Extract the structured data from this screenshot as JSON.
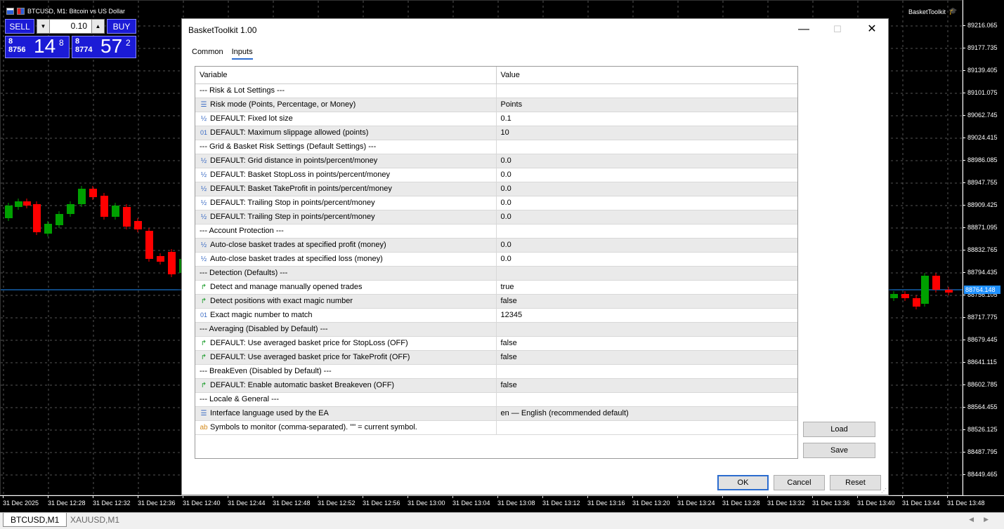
{
  "chart": {
    "symbol_title": "BTCUSD, M1:  Bitcoin vs US Dollar",
    "ea_name": "BasketToolkit",
    "price_ticks": [
      "89216.065",
      "89177.735",
      "89139.405",
      "89101.075",
      "89062.745",
      "89024.415",
      "88986.085",
      "88947.755",
      "88909.425",
      "88871.095",
      "88832.765",
      "88794.435",
      "88756.105",
      "88717.775",
      "88679.445",
      "88641.115",
      "88602.785",
      "88564.455",
      "88526.125",
      "88487.795",
      "88449.465"
    ],
    "current_price": "88764.148",
    "time_ticks": [
      "31 Dec 2025",
      "31 Dec 12:28",
      "31 Dec 12:32",
      "31 Dec 12:36",
      "31 Dec 12:40",
      "31 Dec 12:44",
      "31 Dec 12:48",
      "31 Dec 12:52",
      "31 Dec 12:56",
      "31 Dec 13:00",
      "31 Dec 13:04",
      "31 Dec 13:08",
      "31 Dec 13:12",
      "31 Dec 13:16",
      "31 Dec 13:20",
      "31 Dec 13:24",
      "31 Dec 13:28",
      "31 Dec 13:32",
      "31 Dec 13:36",
      "31 Dec 13:40",
      "31 Dec 13:44",
      "31 Dec 13:48"
    ],
    "colors": {
      "bull": "#00a000",
      "bear": "#ff0000",
      "price_line": "#1e90ff"
    }
  },
  "trade_panel": {
    "sell_label": "SELL",
    "buy_label": "BUY",
    "volume": "0.10",
    "sell_price": {
      "line1": "8",
      "line2": "8756",
      "big": "14",
      "sup": "8"
    },
    "buy_price": {
      "line1": "8",
      "line2": "8774",
      "big": "57",
      "sup": "2"
    }
  },
  "tabs_bottom": [
    "BTCUSD,M1",
    "XAUUSD,M1"
  ],
  "dialog": {
    "title": "BasketToolkit 1.00",
    "tabs": [
      "Common",
      "Inputs"
    ],
    "active_tab": "Inputs",
    "col_variable": "Variable",
    "col_value": "Value",
    "rows": [
      {
        "icon": "",
        "variable": "--- Risk & Lot Settings ---",
        "value": ""
      },
      {
        "icon": "enum",
        "variable": "Risk mode (Points, Percentage, or Money)",
        "value": "Points"
      },
      {
        "icon": "frac",
        "variable": "DEFAULT: Fixed lot size",
        "value": "0.1"
      },
      {
        "icon": "int",
        "variable": "DEFAULT: Maximum slippage allowed (points)",
        "value": "10"
      },
      {
        "icon": "",
        "variable": "--- Grid & Basket Risk Settings (Default Settings) ---",
        "value": ""
      },
      {
        "icon": "frac",
        "variable": "DEFAULT: Grid distance in points/percent/money",
        "value": "0.0"
      },
      {
        "icon": "frac",
        "variable": "DEFAULT: Basket StopLoss in points/percent/money",
        "value": "0.0"
      },
      {
        "icon": "frac",
        "variable": "DEFAULT: Basket TakeProfit in points/percent/money",
        "value": "0.0"
      },
      {
        "icon": "frac",
        "variable": "DEFAULT: Trailing Stop in points/percent/money",
        "value": "0.0"
      },
      {
        "icon": "frac",
        "variable": "DEFAULT: Trailing Step in points/percent/money",
        "value": "0.0"
      },
      {
        "icon": "",
        "variable": "--- Account Protection ---",
        "value": ""
      },
      {
        "icon": "frac",
        "variable": "Auto-close basket trades at specified profit (money)",
        "value": "0.0"
      },
      {
        "icon": "frac",
        "variable": "Auto-close basket trades at specified loss (money)",
        "value": "0.0"
      },
      {
        "icon": "",
        "variable": "--- Detection (Defaults) ---",
        "value": ""
      },
      {
        "icon": "bool",
        "variable": "Detect and manage manually opened trades",
        "value": "true"
      },
      {
        "icon": "bool",
        "variable": "Detect positions with exact magic number",
        "value": "false"
      },
      {
        "icon": "int",
        "variable": "Exact magic number to match",
        "value": "12345"
      },
      {
        "icon": "",
        "variable": "--- Averaging (Disabled by Default) ---",
        "value": ""
      },
      {
        "icon": "bool",
        "variable": "DEFAULT: Use averaged basket price for StopLoss (OFF)",
        "value": "false"
      },
      {
        "icon": "bool",
        "variable": "DEFAULT: Use averaged basket price for TakeProfit (OFF)",
        "value": "false"
      },
      {
        "icon": "",
        "variable": "--- BreakEven (Disabled by Default) ---",
        "value": ""
      },
      {
        "icon": "bool",
        "variable": "DEFAULT: Enable automatic basket Breakeven (OFF)",
        "value": "false"
      },
      {
        "icon": "",
        "variable": "--- Locale & General ---",
        "value": ""
      },
      {
        "icon": "enum",
        "variable": "Interface language used by the EA",
        "value": "en — English (recommended default)"
      },
      {
        "icon": "str",
        "variable": "Symbols to monitor (comma-separated). \"\" = current symbol.",
        "value": ""
      }
    ],
    "load_label": "Load",
    "save_label": "Save",
    "ok_label": "OK",
    "cancel_label": "Cancel",
    "reset_label": "Reset"
  }
}
